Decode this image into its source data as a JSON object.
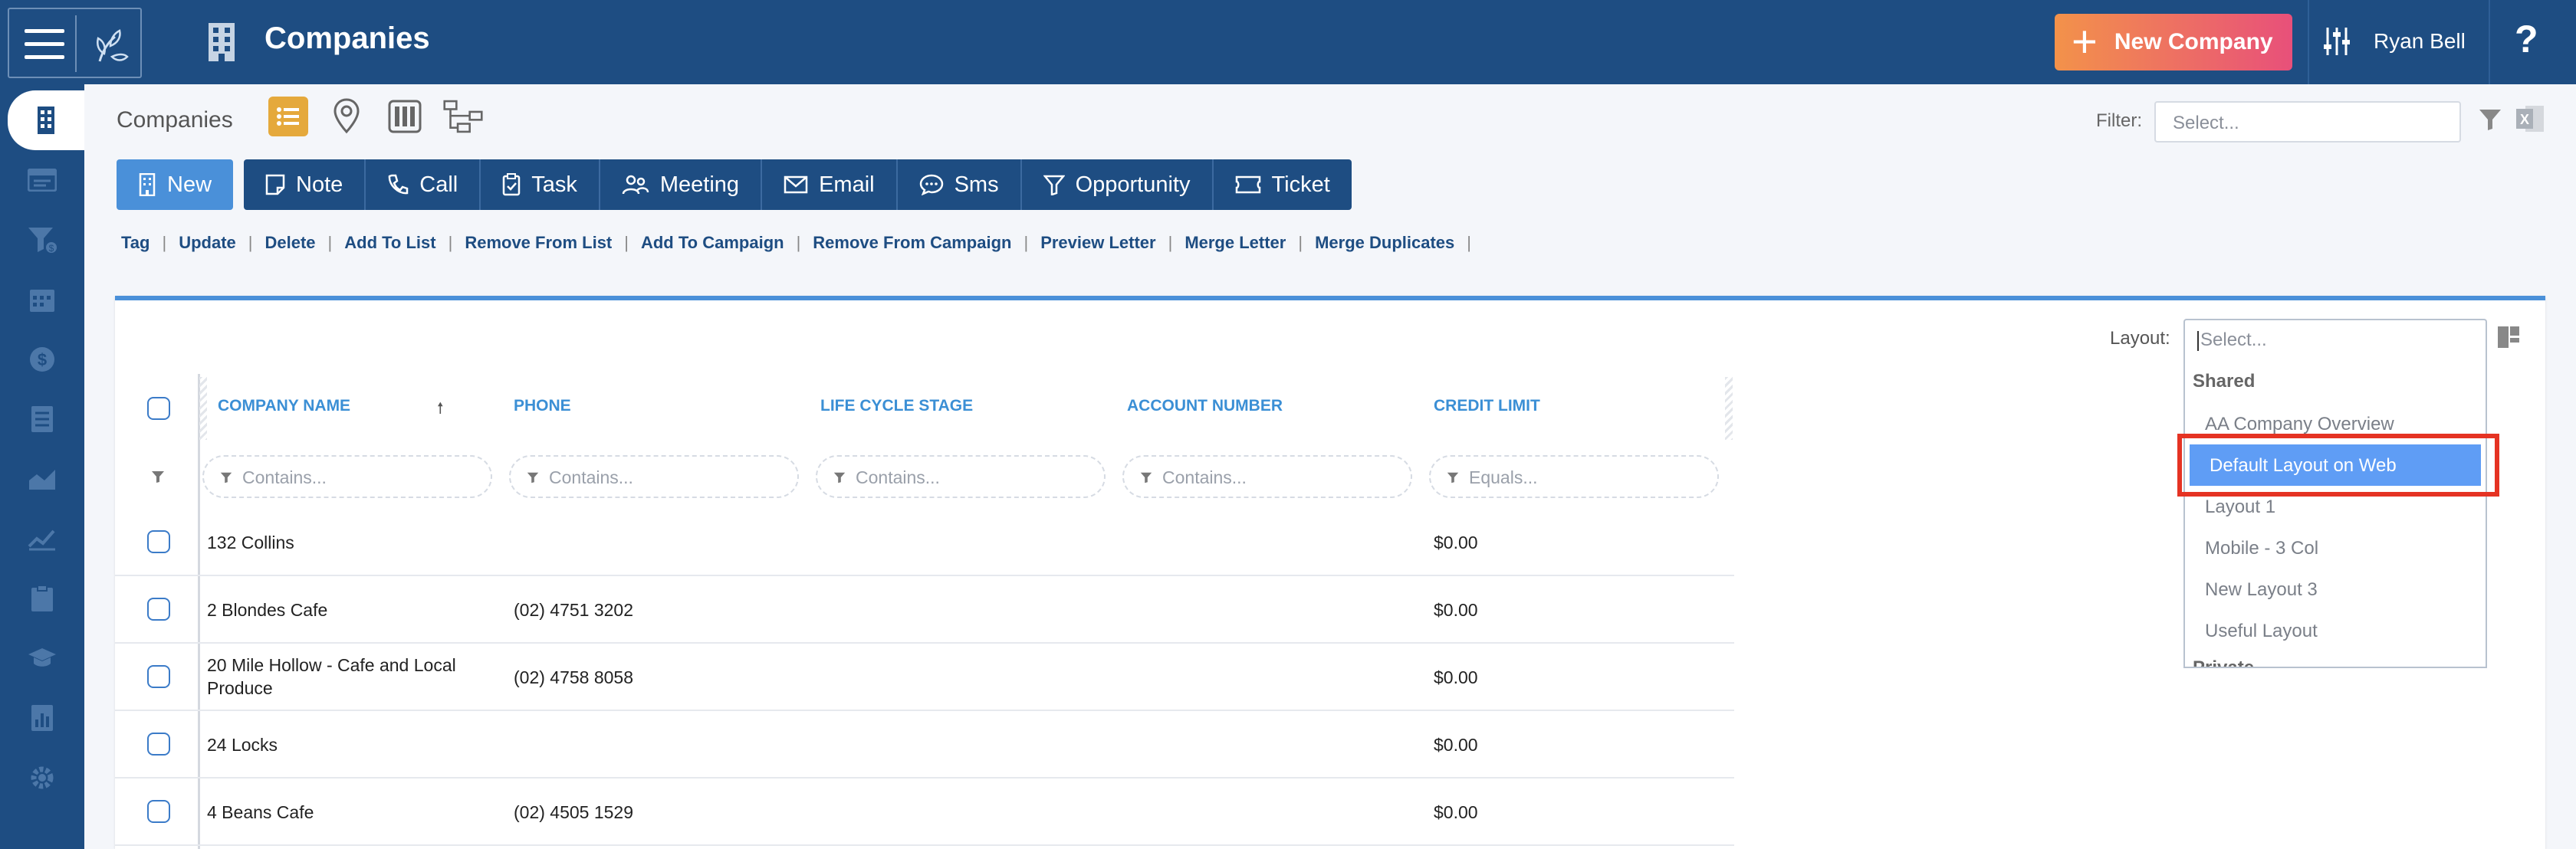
{
  "header": {
    "title": "Companies",
    "new_company_label": "New Company",
    "user_name": "Ryan Bell",
    "help": "?"
  },
  "toolbar": {
    "breadcrumb": "Companies",
    "filter_label": "Filter:",
    "filter_placeholder": "Select..."
  },
  "actions": [
    {
      "label": "New",
      "icon": "building-icon"
    },
    {
      "label": "Note",
      "icon": "note-icon"
    },
    {
      "label": "Call",
      "icon": "phone-icon"
    },
    {
      "label": "Task",
      "icon": "clipboard-icon"
    },
    {
      "label": "Meeting",
      "icon": "meeting-icon"
    },
    {
      "label": "Email",
      "icon": "envelope-icon"
    },
    {
      "label": "Sms",
      "icon": "sms-icon"
    },
    {
      "label": "Opportunity",
      "icon": "funnel-icon"
    },
    {
      "label": "Ticket",
      "icon": "ticket-icon"
    }
  ],
  "links": [
    "Tag",
    "Update",
    "Delete",
    "Add To List",
    "Remove From List",
    "Add To Campaign",
    "Remove From Campaign",
    "Preview Letter",
    "Merge Letter",
    "Merge Duplicates"
  ],
  "layout": {
    "label": "Layout:",
    "placeholder": "Select...",
    "group_shared": "Shared",
    "options": [
      "AA Company Overview",
      "Default Layout on Web",
      "Layout 1",
      "Mobile - 3 Col",
      "New Layout 3",
      "Useful Layout"
    ],
    "selected": "Default Layout on Web",
    "group_private": "Private"
  },
  "table": {
    "columns": [
      "Company Name",
      "Phone",
      "Life Cycle Stage",
      "Account Number",
      "Credit Limit"
    ],
    "sort_indicator": "🠕",
    "filters": [
      "Contains...",
      "Contains...",
      "Contains...",
      "Contains...",
      "Equals..."
    ],
    "rows": [
      {
        "name": "132 Collins",
        "phone": "",
        "stage": "",
        "account": "",
        "credit": "$0.00"
      },
      {
        "name": "2 Blondes Cafe",
        "phone": "(02) 4751 3202",
        "stage": "",
        "account": "",
        "credit": "$0.00"
      },
      {
        "name": "20 Mile Hollow - Cafe and Local Produce",
        "phone": "(02) 4758 8058",
        "stage": "",
        "account": "",
        "credit": "$0.00"
      },
      {
        "name": "24 Locks",
        "phone": "",
        "stage": "",
        "account": "",
        "credit": "$0.00"
      },
      {
        "name": "4 Beans Cafe",
        "phone": "(02) 4505 1529",
        "stage": "",
        "account": "",
        "credit": "$0.00"
      }
    ]
  },
  "colors": {
    "navy": "#1e4d82",
    "accent_blue": "#4a90d9",
    "highlight_red": "#e53323",
    "selected_option": "#5f9df5"
  }
}
